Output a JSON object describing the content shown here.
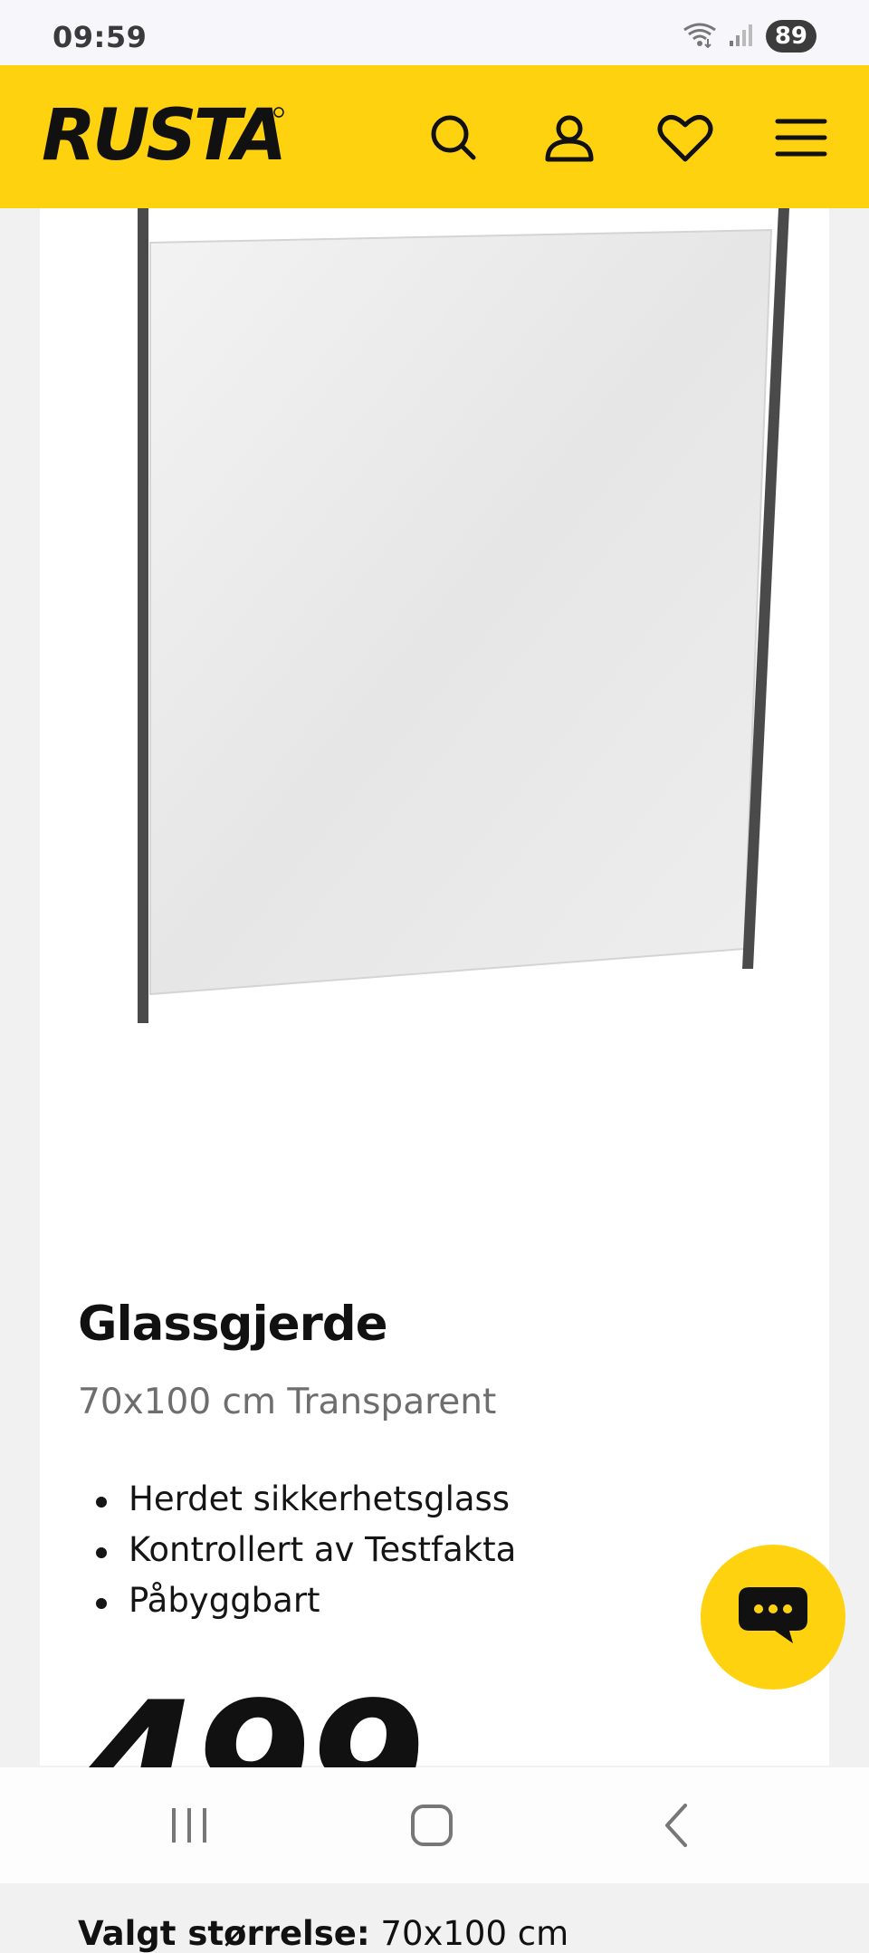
{
  "status_bar": {
    "time": "09:59",
    "battery": "89"
  },
  "header": {
    "brand": "RUSTA",
    "icons": [
      "search-icon",
      "account-icon",
      "heart-icon",
      "menu-icon"
    ],
    "background_color": "#ffd20f"
  },
  "product": {
    "title": "Glassgjerde",
    "subtitle": "70x100 cm Transparent",
    "features": [
      "Herdet sikkerhetsglass",
      "Kontrollert av Testfakta",
      "Påbyggbart"
    ],
    "price": "499",
    "selected_size_label": "Valgt størrelse:",
    "selected_size_value": "70x100 cm"
  },
  "chat": {
    "icon": "chat-icon",
    "color": "#ffd20f"
  },
  "nav": {
    "icons": [
      "recent-apps-icon",
      "home-icon",
      "back-icon"
    ]
  }
}
